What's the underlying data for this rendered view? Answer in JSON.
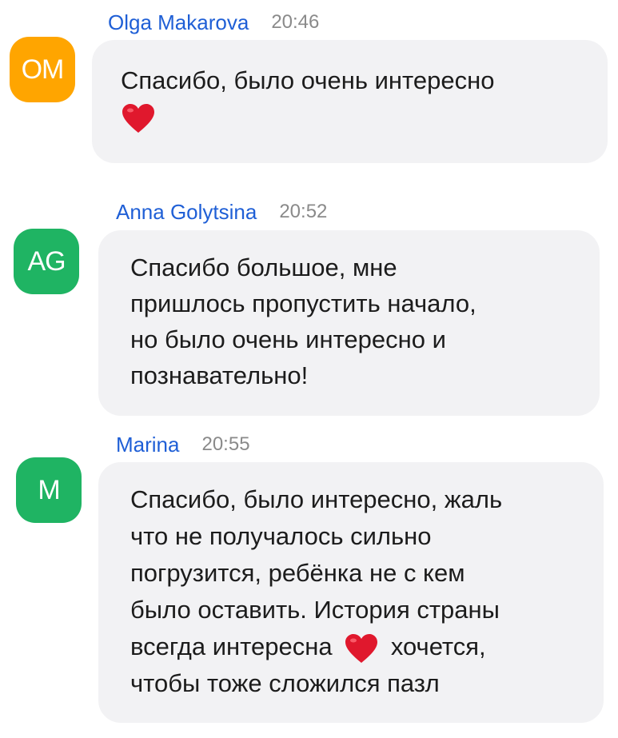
{
  "messages": [
    {
      "avatar_initials": "OM",
      "avatar_color": "#ffa500",
      "sender": "Olga Makarova",
      "time": "20:46",
      "lines": [
        "Спасибо, было очень интересно"
      ]
    },
    {
      "avatar_initials": "AG",
      "avatar_color": "#1fb463",
      "sender": "Anna Golytsina",
      "time": "20:52",
      "lines": [
        "Спасибо большое, мне",
        "пришлось пропустить начало,",
        "но было очень интересно и",
        "познавательно!"
      ]
    },
    {
      "avatar_initials": "M",
      "avatar_color": "#1fb463",
      "sender": "Marina",
      "time": "20:55",
      "lines": [
        "Спасибо, было интересно, жаль",
        "что не получалось сильно",
        "погрузится, ребёнка не с кем",
        "было оставить. История страны",
        "всегда интересна",
        "хочется,",
        "чтобы тоже сложился пазл"
      ]
    }
  ],
  "icons": {
    "heart": "heart-emoji-icon"
  },
  "colors": {
    "sender": "#1f5fd6",
    "time": "#8a8a8a",
    "bubble": "#f2f2f4",
    "heart": "#e0182d"
  }
}
